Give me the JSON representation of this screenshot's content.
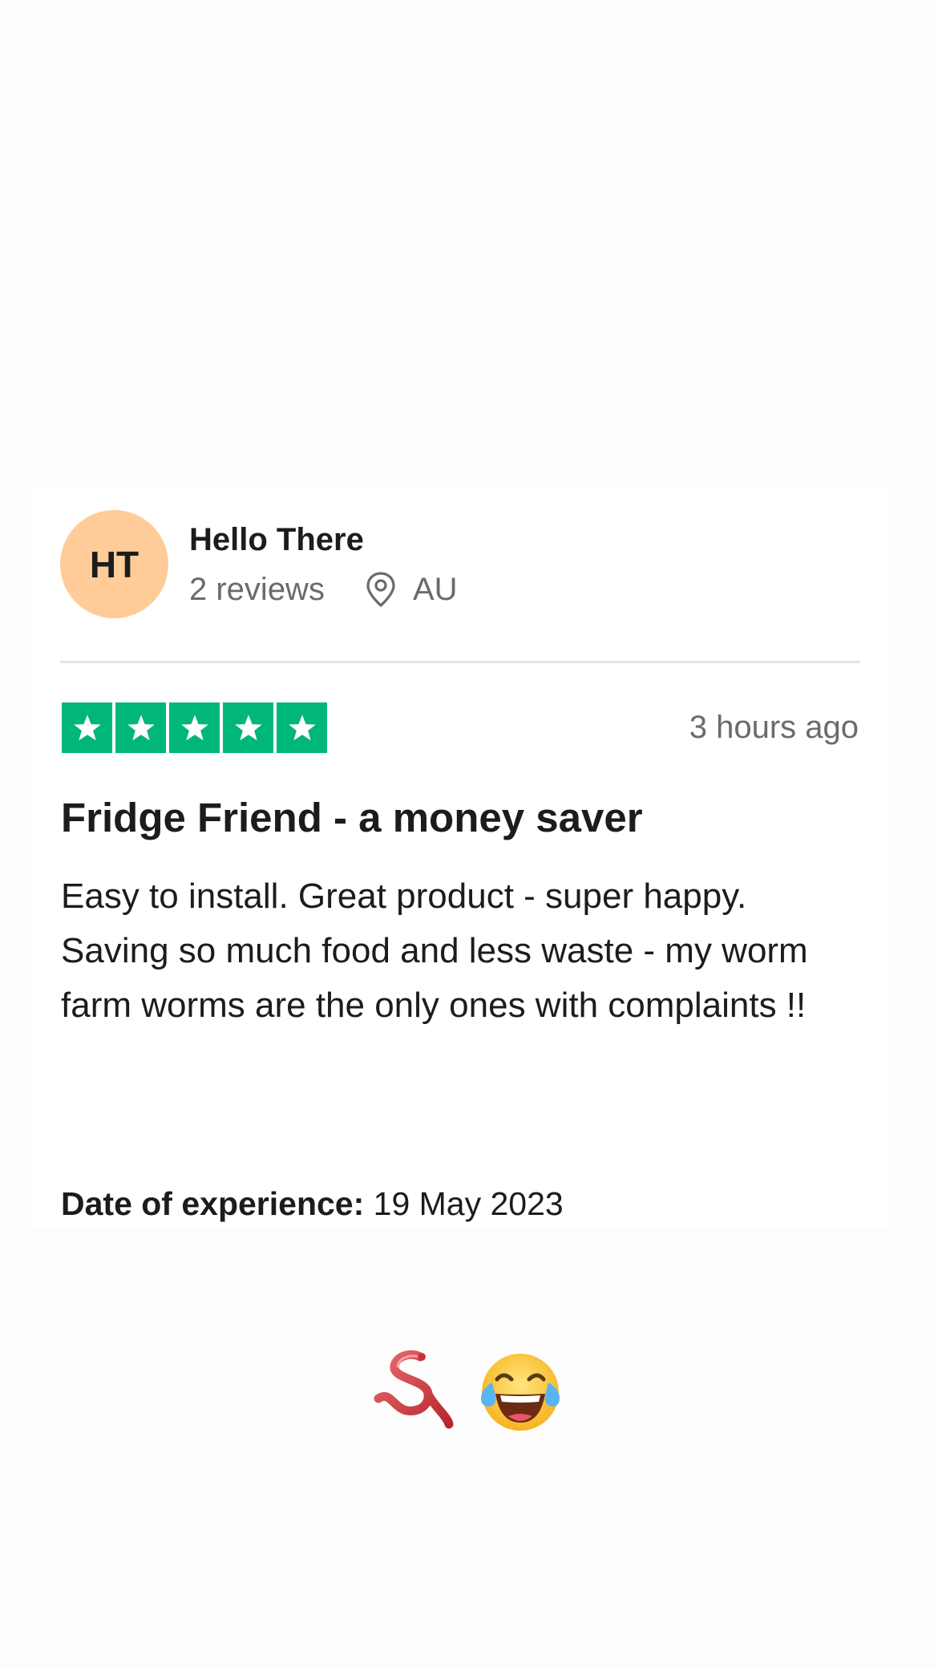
{
  "reviewer": {
    "initials": "HT",
    "name": "Hello There",
    "review_count": "2 reviews",
    "country": "AU"
  },
  "review": {
    "rating": 5,
    "rating_max": 5,
    "time_ago": "3 hours ago",
    "title": "Fridge Friend - a money saver",
    "body_lines": [
      "Easy to install. Great product - super happy.",
      "Saving so much food and less waste - my worm farm worms are the only ones with complaints !!"
    ],
    "experience_label": "Date of experience:",
    "experience_date": "19 May 2023"
  },
  "emojis": [
    "worm-emoji",
    "face-with-tears-of-joy-emoji"
  ],
  "colors": {
    "avatar_bg": "#ffcc99",
    "star_green": "#00b67a",
    "muted_text": "#6b6b6b",
    "divider": "#e3e3e3"
  }
}
